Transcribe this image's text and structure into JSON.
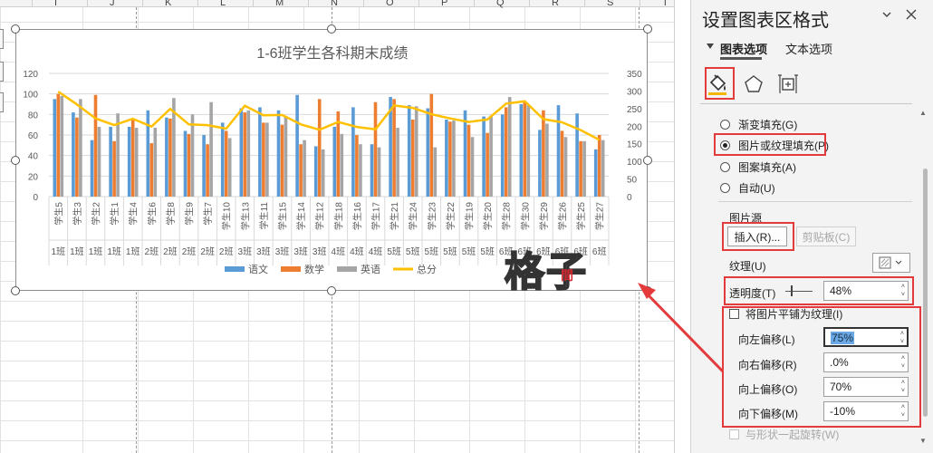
{
  "sheet": {
    "columns": [
      "I",
      "J",
      "K",
      "L",
      "M",
      "N",
      "O",
      "P",
      "Q",
      "R",
      "S",
      "T"
    ]
  },
  "chart_data": {
    "type": "bar",
    "title": "1-6班学生各科期末成绩",
    "students": [
      "学生5",
      "学生3",
      "学生2",
      "学生1",
      "学生4",
      "学生6",
      "学生8",
      "学生9",
      "学生7",
      "学生10",
      "学生13",
      "学生11",
      "学生15",
      "学生14",
      "学生12",
      "学生18",
      "学生16",
      "学生17",
      "学生21",
      "学生24",
      "学生23",
      "学生22",
      "学生19",
      "学生20",
      "学生28",
      "学生30",
      "学生29",
      "学生26",
      "学生25",
      "学生27"
    ],
    "classes": [
      "1班",
      "1班",
      "1班",
      "1班",
      "1班",
      "2班",
      "2班",
      "2班",
      "2班",
      "2班",
      "3班",
      "3班",
      "3班",
      "3班",
      "3班",
      "4班",
      "4班",
      "4班",
      "5班",
      "5班",
      "5班",
      "5班",
      "5班",
      "5班",
      "6班",
      "6班",
      "6班",
      "6班",
      "6班",
      "6班"
    ],
    "ylim_left": [
      0,
      120
    ],
    "yticks_left": [
      "0",
      "20",
      "40",
      "60",
      "80",
      "100",
      "120"
    ],
    "ylim_right": [
      0,
      350
    ],
    "yticks_right": [
      "0",
      "50",
      "100",
      "150",
      "200",
      "250",
      "300",
      "350"
    ],
    "legend_position": "bottom",
    "series": [
      {
        "name": "语文",
        "type": "bar",
        "axis": "left",
        "color": "#5b9bd5",
        "values": [
          95,
          82,
          55,
          68,
          68,
          84,
          77,
          64,
          60,
          72,
          86,
          87,
          84,
          99,
          49,
          68,
          87,
          51,
          97,
          89,
          86,
          75,
          84,
          78,
          80,
          90,
          65,
          89,
          81,
          46
        ]
      },
      {
        "name": "数学",
        "type": "bar",
        "axis": "left",
        "color": "#ed7d31",
        "values": [
          100,
          77,
          99,
          54,
          76,
          52,
          76,
          61,
          51,
          64,
          82,
          72,
          70,
          51,
          95,
          83,
          60,
          92,
          95,
          75,
          100,
          73,
          70,
          62,
          87,
          92,
          84,
          64,
          54,
          60
        ]
      },
      {
        "name": "英语",
        "type": "bar",
        "axis": "left",
        "color": "#a5a5a5",
        "values": [
          98,
          95,
          68,
          81,
          67,
          67,
          96,
          80,
          92,
          57,
          84,
          72,
          78,
          55,
          46,
          61,
          51,
          48,
          67,
          88,
          48,
          74,
          58,
          79,
          97,
          89,
          71,
          58,
          54,
          55
        ]
      },
      {
        "name": "总分",
        "type": "line",
        "axis": "right",
        "color": "#ffc000",
        "values": [
          298,
          262,
          222,
          203,
          221,
          199,
          249,
          205,
          203,
          193,
          258,
          231,
          232,
          205,
          190,
          212,
          198,
          191,
          259,
          252,
          234,
          222,
          212,
          219,
          264,
          271,
          220,
          211,
          189,
          161
        ]
      }
    ]
  },
  "watermark": {
    "big": "格子",
    "small": "間"
  },
  "pane": {
    "title": "设置图表区格式",
    "dropdown_icon": "chevron-down-icon",
    "close_icon": "close-icon",
    "tab_chart": "图表选项",
    "tab_text": "文本选项",
    "fill_options": [
      {
        "label": "渐变填充(G)",
        "checked": false
      },
      {
        "label": "图片或纹理填充(P)",
        "checked": true
      },
      {
        "label": "图案填充(A)",
        "checked": false
      },
      {
        "label": "自动(U)",
        "checked": false
      }
    ],
    "picture_source_label": "图片源",
    "insert_button": "插入(R)...",
    "clipboard_button": "剪贴板(C)",
    "texture_label": "纹理(U)",
    "transparency_label": "透明度(T)",
    "transparency_value": "48%",
    "tile_label": "将图片平铺为纹理(I)",
    "offset_left_label": "向左偏移(L)",
    "offset_left_value": "75%",
    "offset_right_label": "向右偏移(R)",
    "offset_right_value": ".0%",
    "offset_top_label": "向上偏移(O)",
    "offset_top_value": "70%",
    "offset_bottom_label": "向下偏移(M)",
    "offset_bottom_value": "-10%",
    "rotate_with_shape_label": "与形状一起旋转(W)"
  },
  "colors": {
    "annotation_red": "#e33b3b",
    "accent_gold": "#ffc000"
  }
}
